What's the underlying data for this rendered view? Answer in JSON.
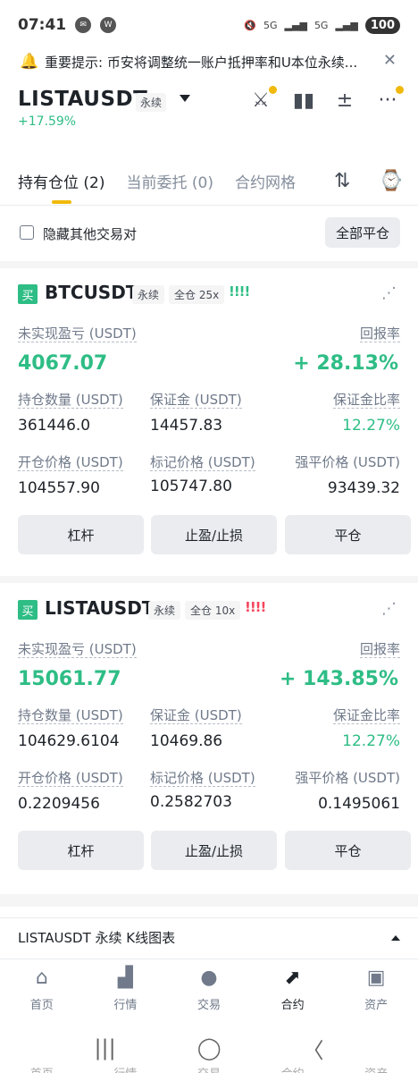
{
  "status": {
    "time": "07:41",
    "network": "5G",
    "network2": "5G",
    "battery": "100"
  },
  "notice": {
    "text": "重要提示: 币安将调整统一账户抵押率和U本位永续..."
  },
  "header": {
    "symbol": "LISTAUSDT",
    "type": "永续",
    "change": "+17.59%"
  },
  "tabs": [
    {
      "label": "持有仓位 (2)"
    },
    {
      "label": "当前委托 (0)"
    },
    {
      "label": "合约网格"
    }
  ],
  "filter": {
    "hide_label": "隐藏其他交易对",
    "close_all": "全部平仓"
  },
  "positions": [
    {
      "side": "买",
      "symbol": "BTCUSDT",
      "type": "永续",
      "margin_mode": "全仓 25x",
      "risk_marks": "!!!!",
      "unrealized_pnl_label": "未实现盈亏 (USDT)",
      "unrealized_pnl": "4067.07",
      "roe_label": "回报率",
      "roe": "+ 28.13%",
      "size_label": "持仓数量 (USDT)",
      "size": "361446.0",
      "margin_label": "保证金 (USDT)",
      "margin": "14457.83",
      "margin_ratio_label": "保证金比率",
      "margin_ratio": "12.27%",
      "entry_label": "开仓价格 (USDT)",
      "entry": "104557.90",
      "mark_label": "标记价格 (USDT)",
      "mark": "105747.80",
      "liq_label": "强平价格 (USDT)",
      "liq": "93439.32",
      "btn_leverage": "杠杆",
      "btn_tpsl": "止盈/止损",
      "btn_close": "平仓"
    },
    {
      "side": "买",
      "symbol": "LISTAUSDT",
      "type": "永续",
      "margin_mode": "全仓 10x",
      "risk_marks": "!!!!",
      "unrealized_pnl_label": "未实现盈亏 (USDT)",
      "unrealized_pnl": "15061.77",
      "roe_label": "回报率",
      "roe": "+ 143.85%",
      "size_label": "持仓数量 (USDT)",
      "size": "104629.6104",
      "margin_label": "保证金 (USDT)",
      "margin": "10469.86",
      "margin_ratio_label": "保证金比率",
      "margin_ratio": "12.27%",
      "entry_label": "开仓价格 (USDT)",
      "entry": "0.2209456",
      "mark_label": "标记价格 (USDT)",
      "mark": "0.2582703",
      "liq_label": "强平价格 (USDT)",
      "liq": "0.1495061",
      "btn_leverage": "杠杆",
      "btn_tpsl": "止盈/止损",
      "btn_close": "平仓"
    }
  ],
  "chart_section": {
    "label": "LISTAUSDT 永续 K线图表"
  },
  "bottom_nav": [
    {
      "label": "首页",
      "icon": "home-icon"
    },
    {
      "label": "行情",
      "icon": "market-icon"
    },
    {
      "label": "交易",
      "icon": "trade-icon"
    },
    {
      "label": "合约",
      "icon": "futures-icon"
    },
    {
      "label": "资产",
      "icon": "wallet-icon"
    }
  ],
  "ghost_nav": [
    "首页",
    "行情",
    "交易",
    "合约",
    "资产"
  ],
  "colors": {
    "green": "#2ebd85",
    "red": "#f6465d",
    "yellow": "#f0b90b"
  }
}
